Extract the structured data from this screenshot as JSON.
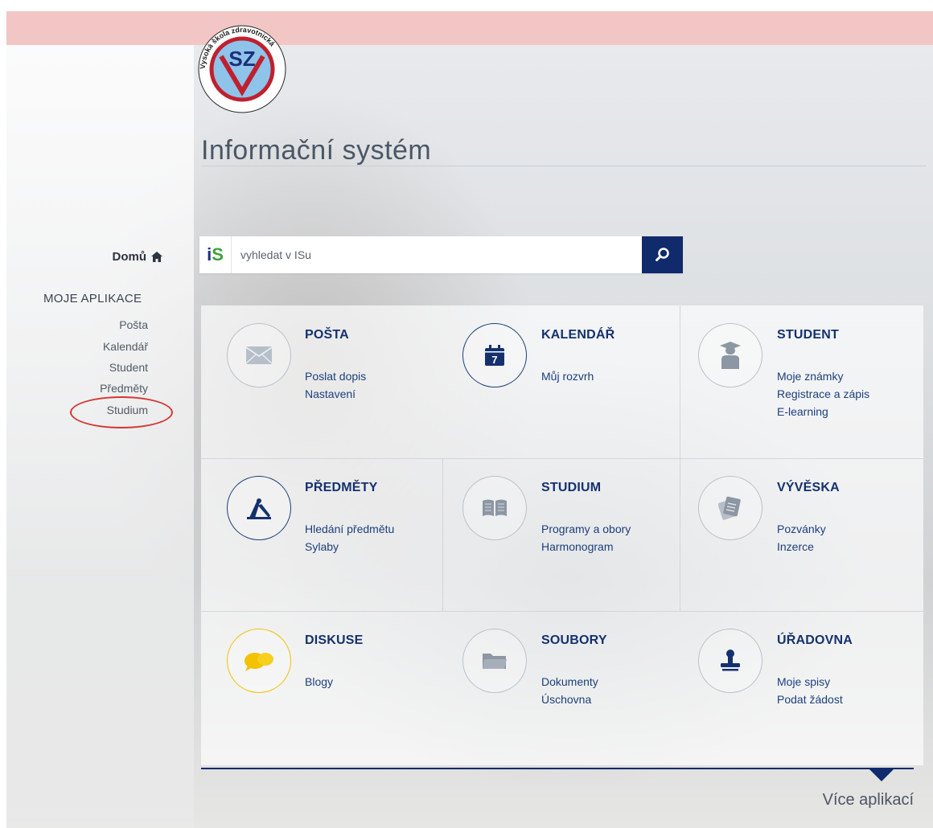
{
  "logo": {
    "center_text": "VSZ",
    "ring_text": "Vysoká škola zdravotnická"
  },
  "header": {
    "title": "Informační systém"
  },
  "sidebar": {
    "home_label": "Domů",
    "section_label": "MOJE APLIKACE",
    "items": [
      {
        "label": "Pošta"
      },
      {
        "label": "Kalendář"
      },
      {
        "label": "Student"
      },
      {
        "label": "Předměty"
      },
      {
        "label": "Studium"
      }
    ]
  },
  "search": {
    "logo_text": "iS",
    "placeholder": "vyhledat v ISu"
  },
  "apps": [
    {
      "title": "POŠTA",
      "icon": "envelope-icon",
      "links": [
        "Poslat dopis",
        "Nastavení"
      ]
    },
    {
      "title": "KALENDÁŘ",
      "icon": "calendar-icon",
      "icon_text": "7",
      "links": [
        "Můj rozvrh"
      ]
    },
    {
      "title": "STUDENT",
      "icon": "graduate-icon",
      "links": [
        "Moje známky",
        "Registrace a zápis",
        "E-learning"
      ]
    },
    {
      "title": "PŘEDMĚTY",
      "icon": "compass-icon",
      "links": [
        "Hledání předmětu",
        "Sylaby"
      ]
    },
    {
      "title": "STUDIUM",
      "icon": "book-icon",
      "links": [
        "Programy a obory",
        "Harmonogram"
      ]
    },
    {
      "title": "VÝVĚSKA",
      "icon": "notes-icon",
      "links": [
        "Pozvánky",
        "Inzerce"
      ]
    },
    {
      "title": "DISKUSE",
      "icon": "chat-bubbles-icon",
      "links": [
        "Blogy"
      ]
    },
    {
      "title": "SOUBORY",
      "icon": "folder-icon",
      "links": [
        "Dokumenty",
        "Úschovna"
      ]
    },
    {
      "title": "ÚŘADOVNA",
      "icon": "stamp-icon",
      "links": [
        "Moje spisy",
        "Podat žádost"
      ]
    }
  ],
  "footer": {
    "more_label": "Více aplikací"
  },
  "colors": {
    "brand_navy": "#102a6b",
    "link": "#1c3f7c",
    "banner": "#f3c6c6",
    "annotation_ring": "#d63535",
    "chat_yellow": "#f2c200",
    "is_green": "#3fa23a"
  }
}
